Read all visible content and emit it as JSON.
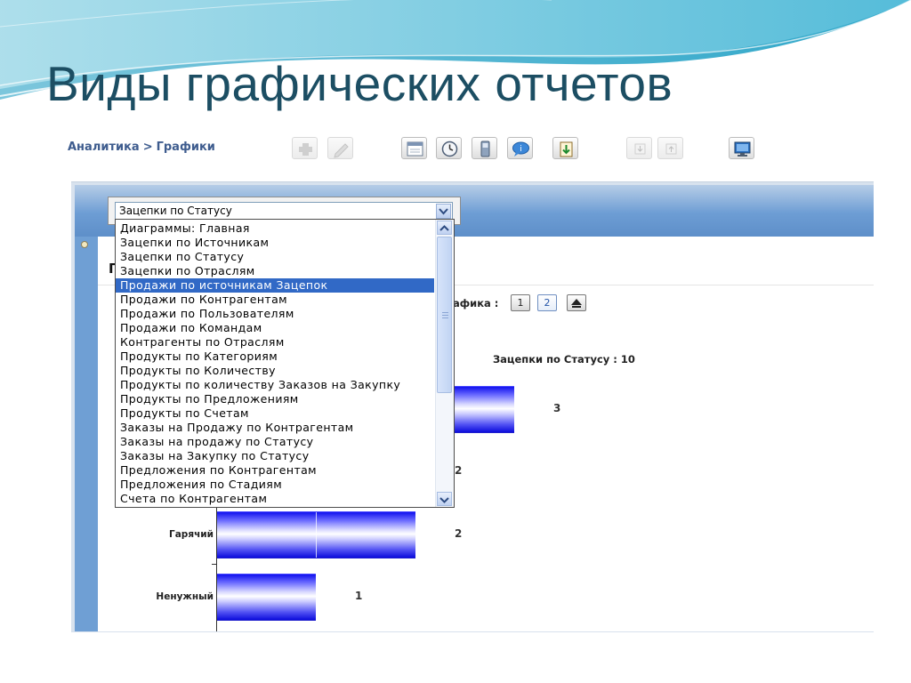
{
  "slide": {
    "title": "Виды графических отчетов"
  },
  "breadcrumb": {
    "parent": "Аналитика",
    "separator": ">",
    "current": "Графики"
  },
  "toolbar": {
    "buttons": [
      {
        "name": "add-button",
        "icon": "plus-icon",
        "enabled": false
      },
      {
        "name": "edit-button",
        "icon": "pencil-icon",
        "enabled": false
      },
      {
        "name": "calendar-button",
        "icon": "calendar-icon",
        "enabled": true
      },
      {
        "name": "history-button",
        "icon": "clock-icon",
        "enabled": true
      },
      {
        "name": "phone-button",
        "icon": "phone-icon",
        "enabled": true
      },
      {
        "name": "chat-button",
        "icon": "speech-bubble-icon",
        "enabled": true
      },
      {
        "name": "export-button",
        "icon": "export-icon",
        "enabled": true
      },
      {
        "name": "move-down-button",
        "icon": "arrow-down-icon",
        "enabled": false
      },
      {
        "name": "move-up-button",
        "icon": "arrow-up-icon",
        "enabled": false
      },
      {
        "name": "display-button",
        "icon": "monitor-icon",
        "enabled": true
      }
    ]
  },
  "report_select": {
    "value": "Зацепки по Статусу",
    "options": [
      "Диаграммы: Главная",
      "Зацепки по Источникам",
      "Зацепки по Статусу",
      "Зацепки по Отраслям",
      "Продажи по источникам Зацепок",
      "Продажи по Контрагентам",
      "Продажи по Пользователям",
      "Продажи по Командам",
      "Контрагенты по Отраслям",
      "Продукты по Категориям",
      "Продукты по Количеству",
      "Продукты по количеству Заказов на Закупку",
      "Продукты по Предложениям",
      "Продукты по Счетам",
      "Заказы на Продажу по Контрагентам",
      "Заказы на продажу по Статусу",
      "Заказы на Закупку по Статусу",
      "Предложения по Контрагентам",
      "Предложения по Стадиям",
      "Счета по Контрагентам"
    ],
    "highlighted_index": 4
  },
  "panel": {
    "heading_fragment": "Г"
  },
  "chart_type": {
    "label": "афика :",
    "buttons": [
      "1",
      "2"
    ],
    "active": "2"
  },
  "chart_data": {
    "type": "bar",
    "orientation": "horizontal",
    "title": "Зацепки по Статусу : 10",
    "categories": [
      "",
      "",
      "Гарячий",
      "Ненужный"
    ],
    "values": [
      3,
      2,
      2,
      1
    ],
    "value_labels": [
      "3",
      "2",
      "2",
      "1"
    ],
    "bar_color": "#1a1aee",
    "grid": false
  }
}
